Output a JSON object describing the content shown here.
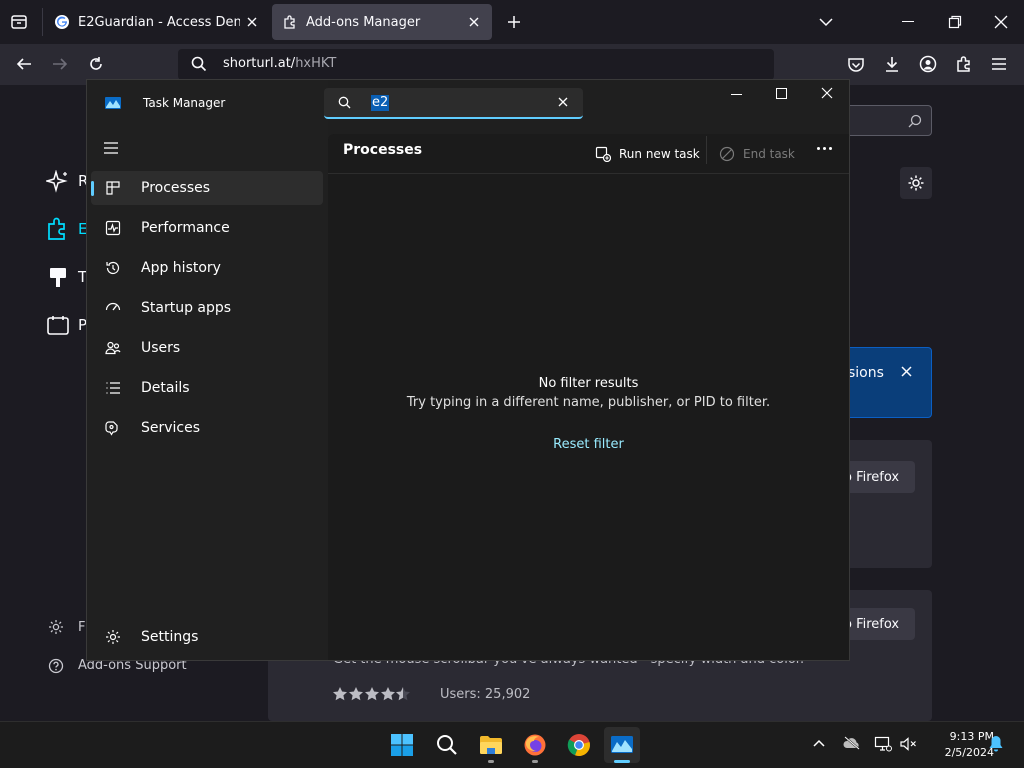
{
  "browser": {
    "tabs": [
      {
        "title": "E2Guardian - Access Denied",
        "active": false
      },
      {
        "title": "Add-ons Manager",
        "active": true
      }
    ],
    "url_host": "shorturl.at/",
    "url_path": "hxHKT"
  },
  "addons_page": {
    "side_partials": [
      "R",
      "E",
      "T",
      "P"
    ],
    "footer_partial": "F",
    "support_label": "Add-ons Support",
    "banner_text": "sions",
    "card_button": "o Firefox",
    "card_desc": "Get the mouse scrollbar you've always wanted—specify width and color.",
    "users_text": "Users: 25,902",
    "rating": 4.5
  },
  "task_manager": {
    "title": "Task Manager",
    "search_value": "e2",
    "section_title": "Processes",
    "run_new_task": "Run new task",
    "end_task": "End task",
    "nav": [
      {
        "label": "Processes",
        "icon": "processes-icon",
        "active": true
      },
      {
        "label": "Performance",
        "icon": "performance-icon",
        "active": false
      },
      {
        "label": "App history",
        "icon": "app-history-icon",
        "active": false
      },
      {
        "label": "Startup apps",
        "icon": "startup-apps-icon",
        "active": false
      },
      {
        "label": "Users",
        "icon": "users-icon",
        "active": false
      },
      {
        "label": "Details",
        "icon": "details-icon",
        "active": false
      },
      {
        "label": "Services",
        "icon": "services-icon",
        "active": false
      }
    ],
    "settings_label": "Settings",
    "no_results_title": "No filter results",
    "no_results_hint": "Try typing in a different name, publisher, or PID to filter.",
    "reset_filter": "Reset filter"
  },
  "taskbar": {
    "time": "9:13 PM",
    "date": "2/5/2024"
  },
  "colors": {
    "accent": "#60cdff",
    "firefox_bg": "#1c1b22",
    "taskmanager_bg": "#1f1f1f"
  }
}
